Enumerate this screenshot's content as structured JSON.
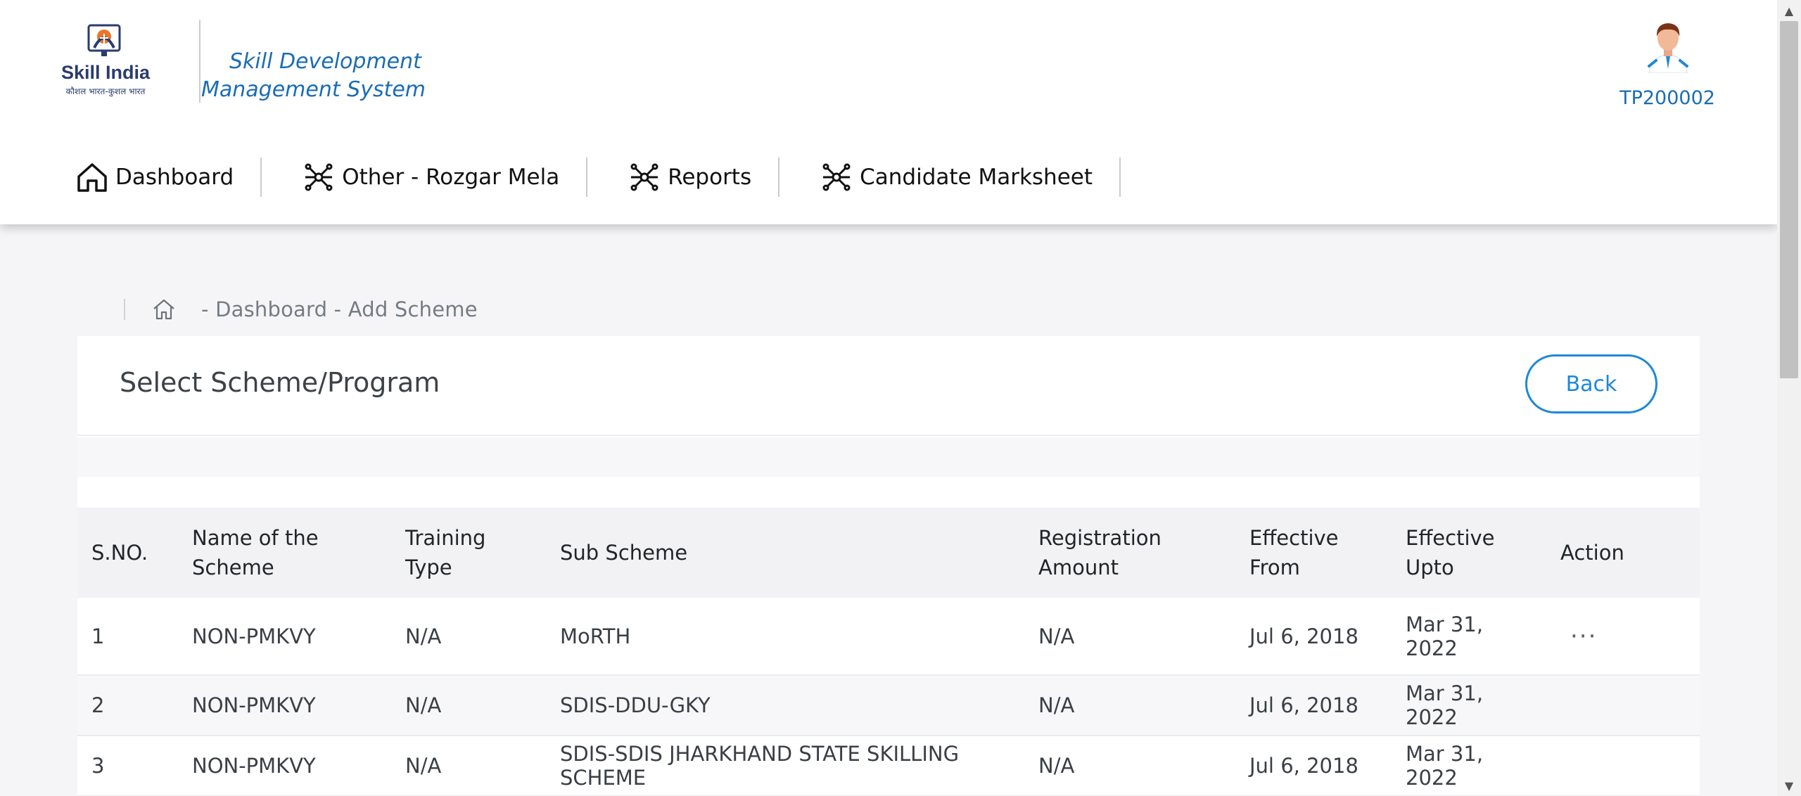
{
  "header": {
    "logo_text": "Skill India",
    "logo_tagline": "कौशल भारत-कुशल भारत",
    "app_title": "Skill Development Management System",
    "user_id": "TP200002"
  },
  "nav": {
    "items": [
      {
        "label": "Dashboard",
        "icon": "home-icon"
      },
      {
        "label": "Other - Rozgar Mela",
        "icon": "network-icon"
      },
      {
        "label": "Reports",
        "icon": "network-icon"
      },
      {
        "label": "Candidate Marksheet",
        "icon": "network-icon"
      }
    ]
  },
  "breadcrumb": {
    "text": "-  Dashboard - Add Scheme"
  },
  "card": {
    "title": "Select Scheme/Program",
    "back_label": "Back"
  },
  "table": {
    "headers": [
      "S.NO.",
      "Name of the Scheme",
      "Training Type",
      "Sub Scheme",
      "Registration Amount",
      "Effective From",
      "Effective Upto",
      "Action"
    ],
    "rows": [
      {
        "sno": "1",
        "name": "NON-PMKVY",
        "type": "N/A",
        "sub": "MoRTH",
        "reg": "N/A",
        "from": "Jul 6, 2018",
        "upto": "Mar 31, 2022",
        "action": "···"
      },
      {
        "sno": "2",
        "name": "NON-PMKVY",
        "type": "N/A",
        "sub": "SDIS-DDU-GKY",
        "reg": "N/A",
        "from": "Jul 6, 2018",
        "upto": "Mar 31, 2022",
        "action": ""
      },
      {
        "sno": "3",
        "name": "NON-PMKVY",
        "type": "N/A",
        "sub": "SDIS-SDIS JHARKHAND STATE SKILLING SCHEME",
        "reg": "N/A",
        "from": "Jul 6, 2018",
        "upto": "Mar 31, 2022",
        "action": ""
      }
    ]
  },
  "colors": {
    "accent": "#1e88d8",
    "title_blue": "#1a6db4",
    "header_bg": "#ffffff",
    "page_bg": "#f5f5f7",
    "table_header_bg": "#f2f2f5"
  }
}
